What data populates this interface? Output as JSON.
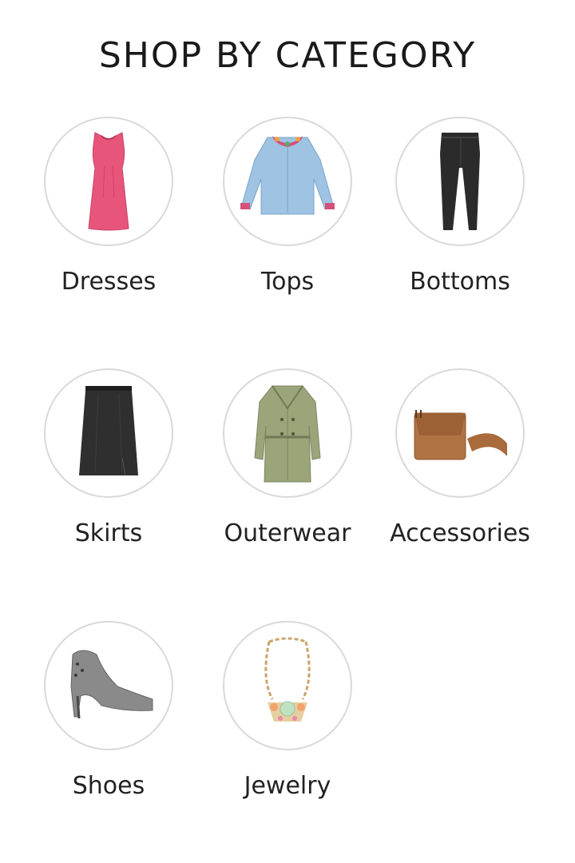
{
  "page": {
    "title": "SHOP BY CATEGORY"
  },
  "categories": [
    {
      "label": "Dresses",
      "icon": "dress-icon",
      "color": "#e8557b"
    },
    {
      "label": "Tops",
      "icon": "blouse-icon",
      "color": "#9fc3e3"
    },
    {
      "label": "Bottoms",
      "icon": "jeans-icon",
      "color": "#2b2b2b"
    },
    {
      "label": "Skirts",
      "icon": "skirt-icon",
      "color": "#2f2f2f"
    },
    {
      "label": "Outerwear",
      "icon": "trench-coat-icon",
      "color": "#9aa57a"
    },
    {
      "label": "Accessories",
      "icon": "bag-icon",
      "color": "#a96a3c"
    },
    {
      "label": "Shoes",
      "icon": "bootie-icon",
      "color": "#8a8a8a"
    },
    {
      "label": "Jewelry",
      "icon": "necklace-icon",
      "color": "#c9a46a"
    }
  ]
}
